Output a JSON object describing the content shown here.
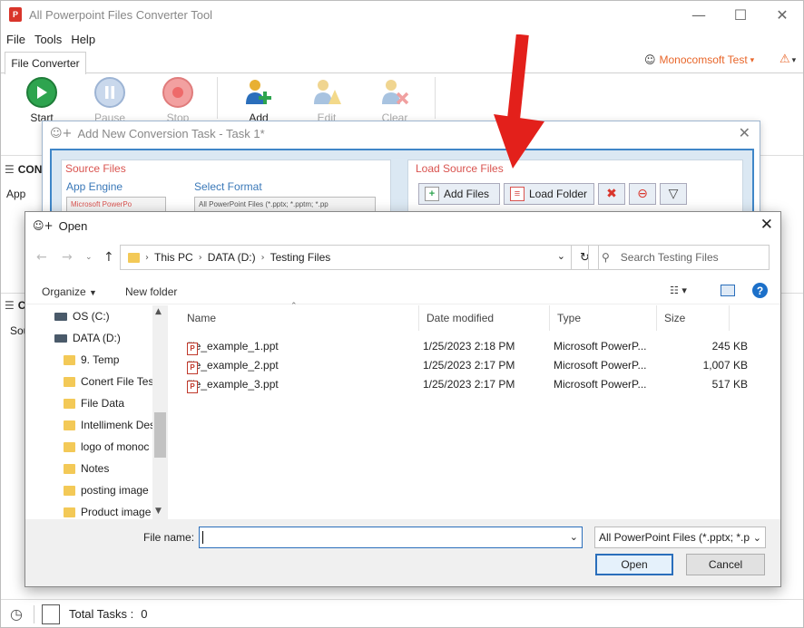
{
  "app": {
    "title": "All Powerpoint Files Converter Tool",
    "logo": "P",
    "minimize": "—",
    "maximize": "☐",
    "close": "✕"
  },
  "menu": [
    "File",
    "Tools",
    "Help"
  ],
  "ribbon": {
    "tab": "File Converter",
    "user": "Monocomsoft Test",
    "user_dd": "▾",
    "alert_dd": "▾"
  },
  "toolbar": {
    "start": "Start",
    "pause": "Pause",
    "stop": "Stop",
    "add": "Add",
    "edit": "Edit",
    "clear": "Clear"
  },
  "background": {
    "section1_label": "CON",
    "app_col": "App",
    "section2_label": "C",
    "sou_col": "Sou"
  },
  "status": {
    "total_tasks_label": "Total Tasks :",
    "total_tasks_value": "0"
  },
  "task_dialog": {
    "title": "Add New Conversion Task - Task 1*",
    "close": "✕",
    "source_files": "Source Files",
    "app_engine": "App Engine",
    "app_engine_value": "Microsoft PowerPo",
    "select_format": "Select Format",
    "select_format_value": "All PowerPoint Files (*.pptx; *.pptm; *.pp",
    "load_source_files": "Load Source Files",
    "add_files": "Add Files",
    "load_folder": "Load Folder"
  },
  "open_dialog": {
    "title": "Open",
    "close": "✕",
    "breadcrumb": [
      "This PC",
      "DATA (D:)",
      "Testing Files"
    ],
    "search_placeholder": "Search Testing Files",
    "organize": "Organize",
    "new_folder": "New folder",
    "help": "?",
    "nav_items": [
      {
        "label": "OS (C:)",
        "type": "drive"
      },
      {
        "label": "DATA (D:)",
        "type": "drive"
      },
      {
        "label": "9. Temp",
        "type": "folder"
      },
      {
        "label": "Conert File Test",
        "type": "folder"
      },
      {
        "label": "File Data",
        "type": "folder"
      },
      {
        "label": "Intellimenk Des",
        "type": "folder"
      },
      {
        "label": "logo of monoc",
        "type": "folder"
      },
      {
        "label": "Notes",
        "type": "folder"
      },
      {
        "label": "posting image",
        "type": "folder"
      },
      {
        "label": "Product image",
        "type": "folder"
      }
    ],
    "columns": [
      "Name",
      "Date modified",
      "Type",
      "Size"
    ],
    "files": [
      {
        "name": "file_example_1.ppt",
        "date": "1/25/2023 2:18 PM",
        "type": "Microsoft PowerP...",
        "size": "245 KB"
      },
      {
        "name": "file_example_2.ppt",
        "date": "1/25/2023 2:17 PM",
        "type": "Microsoft PowerP...",
        "size": "1,007 KB"
      },
      {
        "name": "file_example_3.ppt",
        "date": "1/25/2023 2:17 PM",
        "type": "Microsoft PowerP...",
        "size": "517 KB"
      }
    ],
    "file_name_label": "File name:",
    "file_name_value": "",
    "filter": "All PowerPoint Files (*.pptx; *.p",
    "open_button": "Open",
    "cancel_button": "Cancel"
  },
  "colors": {
    "accent": "#2a6ebb",
    "brand_orange": "#e8662a",
    "arrow_red": "#e3201b",
    "label_red": "#d9534f"
  }
}
